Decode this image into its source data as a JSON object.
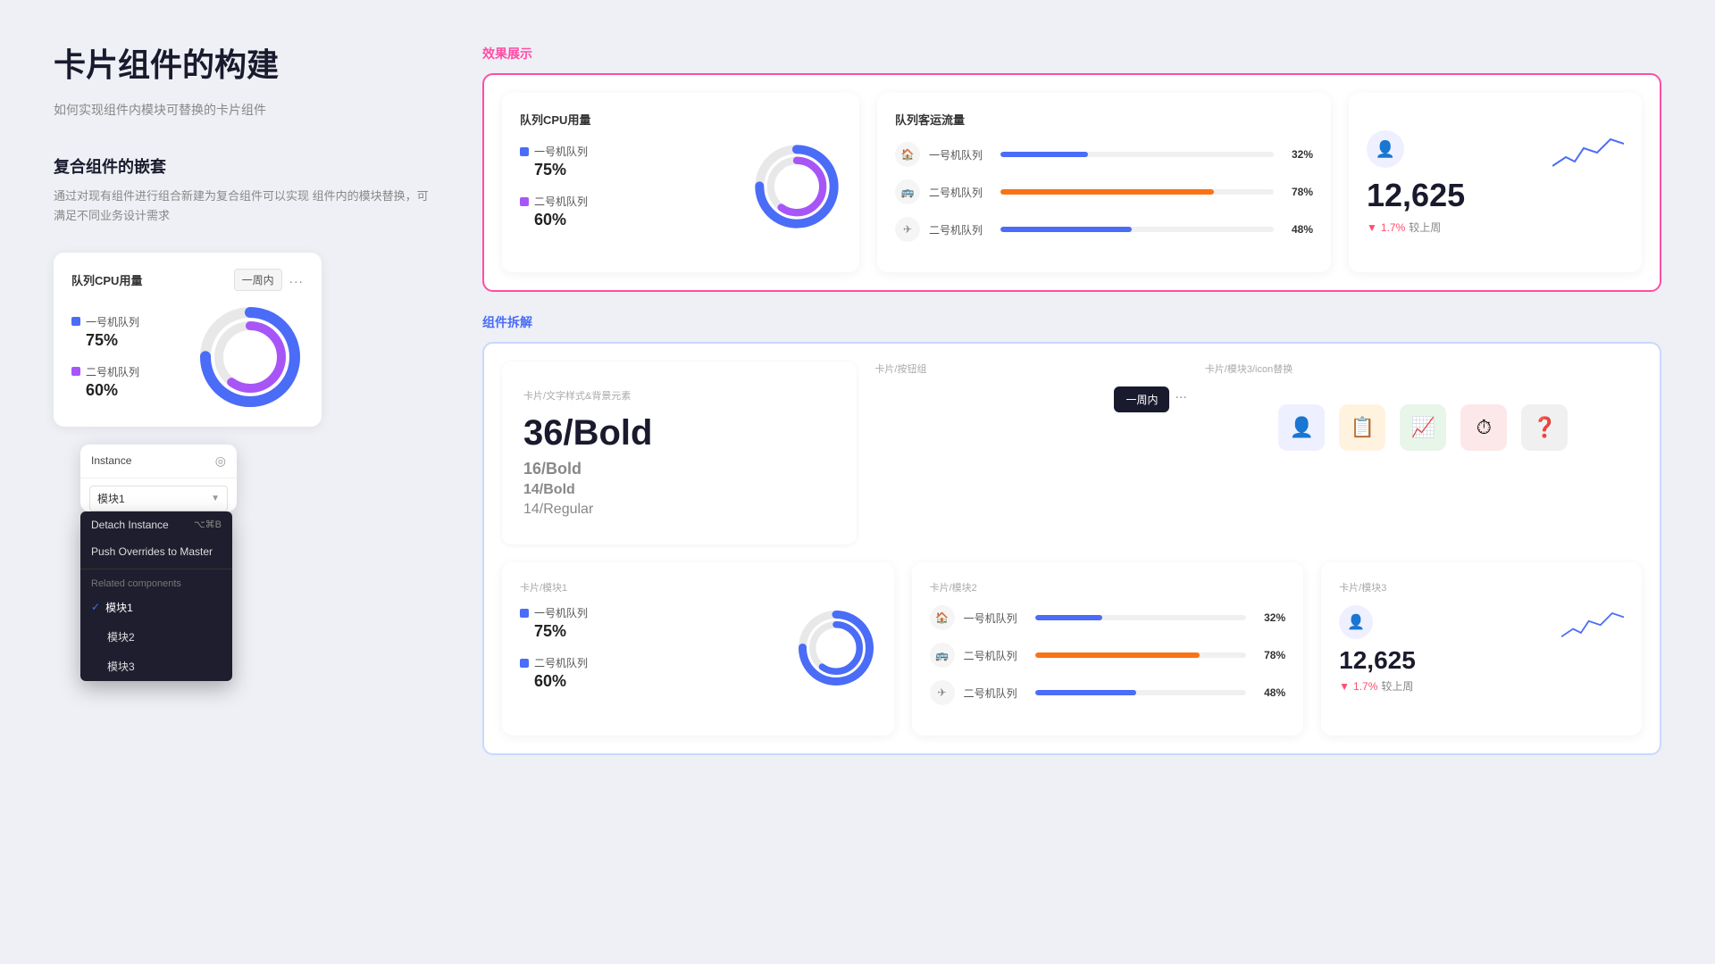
{
  "page": {
    "bg": "#eef0f5"
  },
  "left": {
    "main_title": "卡片组件的构建",
    "main_subtitle": "如何实现组件内模块可替换的卡片组件",
    "section_title": "复合组件的嵌套",
    "section_desc": "通过对现有组件进行组合新建为复合组件可以实现\n组件内的模块替换，可满足不同业务设计需求",
    "mini_card": {
      "title": "队列CPU用量",
      "week_label": "一周内",
      "dots": "...",
      "legend": [
        {
          "label": "一号机队列",
          "value": "75%",
          "color": "blue"
        },
        {
          "label": "二号机队列",
          "value": "60%",
          "color": "purple"
        }
      ]
    },
    "instance": {
      "title": "Instance",
      "select_value": "模块1",
      "detach_label": "Detach Instance",
      "detach_shortcut": "⌥⌘B",
      "push_label": "Push Overrides to Master",
      "related_label": "Related components",
      "items": [
        {
          "label": "模块1",
          "checked": true
        },
        {
          "label": "模块2",
          "checked": false
        },
        {
          "label": "模块3",
          "checked": false
        }
      ]
    }
  },
  "right": {
    "preview_label": "效果展示",
    "decompose_label": "组件拆解",
    "preview": {
      "cpu_card": {
        "title": "队列CPU用量",
        "legend": [
          {
            "label": "一号机队列",
            "value": "75%",
            "color": "#4a6cf7"
          },
          {
            "label": "二号机队列",
            "value": "60%",
            "color": "#a855f7"
          }
        ]
      },
      "traffic_card": {
        "title": "队列客运流量",
        "rows": [
          {
            "icon": "🏠",
            "name": "一号机队列",
            "pct": 32,
            "color": "#4a6cf7",
            "label": "32%"
          },
          {
            "icon": "🚌",
            "name": "二号机队列",
            "pct": 78,
            "color": "#f97316",
            "label": "78%"
          },
          {
            "icon": "✈",
            "name": "二号机队列",
            "pct": 48,
            "color": "#4a6cf7",
            "label": "48%"
          }
        ]
      },
      "metric_card": {
        "value": "12,625",
        "trend_pct": "1.7%",
        "trend_label": "较上周"
      }
    },
    "decompose": {
      "text_card": {
        "title": "卡片/文字样式&背景元素",
        "sizes": [
          "36/Bold",
          "16/Bold",
          "14/Bold",
          "14/Regular"
        ]
      },
      "btn_card": {
        "title": "卡片/按钮组",
        "week_label": "一周内",
        "dots": "..."
      },
      "icon_card": {
        "title": "卡片/模块3/icon替换",
        "icons": [
          {
            "emoji": "👤",
            "bg": "blue-light"
          },
          {
            "emoji": "📋",
            "bg": "orange"
          },
          {
            "emoji": "📈",
            "bg": "green"
          },
          {
            "emoji": "⏱",
            "bg": "red-light"
          },
          {
            "emoji": "❓",
            "bg": "gray"
          }
        ]
      },
      "mod1": {
        "title": "卡片/模块1",
        "legend": [
          {
            "label": "一号机队列",
            "value": "75%",
            "color": "#4a6cf7"
          },
          {
            "label": "二号机队列",
            "value": "60%",
            "color": "#4a6cf7"
          }
        ]
      },
      "mod2": {
        "title": "卡片/模块2",
        "rows": [
          {
            "icon": "🏠",
            "name": "一号机队列",
            "pct": 32,
            "color": "#4a6cf7",
            "label": "32%"
          },
          {
            "icon": "🚌",
            "name": "二号机队列",
            "pct": 78,
            "color": "#f97316",
            "label": "78%"
          },
          {
            "icon": "✈",
            "name": "二号机队列",
            "pct": 48,
            "color": "#4a6cf7",
            "label": "48%"
          }
        ]
      },
      "mod3": {
        "title": "卡片/模块3",
        "value": "12,625",
        "trend_pct": "1.7%",
        "trend_label": "较上周"
      }
    }
  }
}
